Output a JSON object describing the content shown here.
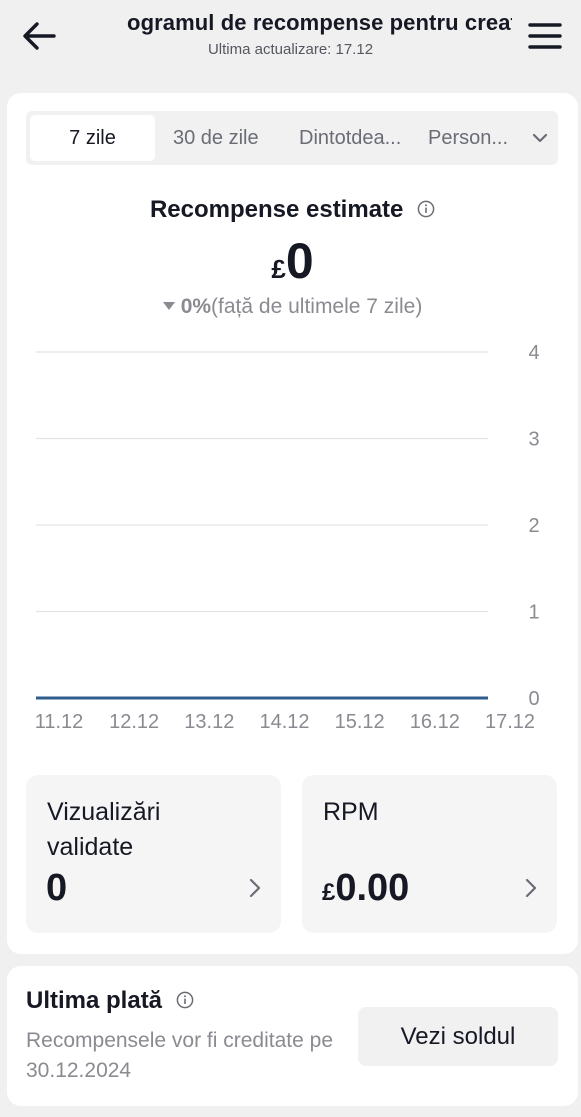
{
  "header": {
    "title": "ogramul de recompense pentru creat",
    "subtitle": "Ultima actualizare: 17.12"
  },
  "tabs": [
    {
      "label": "7 zile",
      "active": true
    },
    {
      "label": "30 de zile",
      "active": false
    },
    {
      "label": "Dintotdea...",
      "active": false
    },
    {
      "label": "Person...",
      "active": false
    }
  ],
  "rewards": {
    "title": "Recompense estimate",
    "currency": "£",
    "value": "0",
    "change_pct": "0%",
    "change_text": "(față de ultimele 7 zile)"
  },
  "chart_data": {
    "type": "line",
    "x": [
      "11.12",
      "12.12",
      "13.12",
      "14.12",
      "15.12",
      "16.12",
      "17.12"
    ],
    "series": [
      {
        "values": [
          0,
          0,
          0,
          0,
          0,
          0,
          0
        ]
      }
    ],
    "y_ticks": [
      "0",
      "1",
      "2",
      "3",
      "4"
    ],
    "ylim": [
      0,
      4
    ],
    "grid": true,
    "y_axis_side": "right",
    "line_color": "#2f5d8c",
    "grid_color": "#e3e3e5"
  },
  "stats": {
    "views": {
      "label": "Vizualizări validate",
      "value": "0"
    },
    "rpm": {
      "label": "RPM",
      "currency": "£",
      "value": "0.00"
    }
  },
  "payment": {
    "title": "Ultima plată",
    "description": "Recompensele vor fi creditate pe 30.12.2024",
    "button_label": "Vezi soldul"
  },
  "icons": {
    "back": "arrow-left-icon",
    "menu": "hamburger-menu-icon",
    "info": "info-circle-icon",
    "chevron_down": "chevron-down-icon",
    "chevron_right": "chevron-right-icon"
  }
}
